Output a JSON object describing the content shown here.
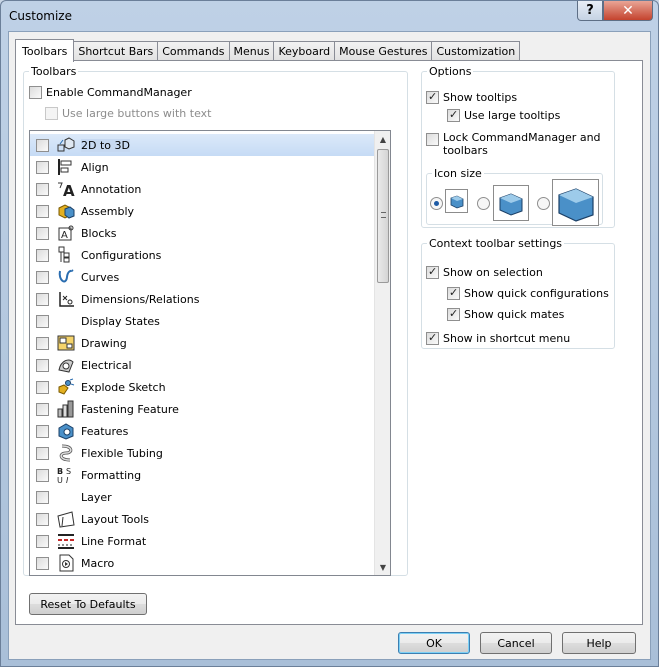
{
  "window": {
    "title": "Customize",
    "help_glyph": "?",
    "close_glyph": "✕"
  },
  "tabs": [
    {
      "label": "Toolbars",
      "active": true
    },
    {
      "label": "Shortcut Bars"
    },
    {
      "label": "Commands"
    },
    {
      "label": "Menus"
    },
    {
      "label": "Keyboard"
    },
    {
      "label": "Mouse Gestures"
    },
    {
      "label": "Customization"
    }
  ],
  "toolbars_group": {
    "legend": "Toolbars",
    "enable_commandmanager": {
      "label": "Enable CommandManager",
      "checked": false
    },
    "use_large_buttons": {
      "label": "Use large buttons with text",
      "checked": false,
      "disabled": true
    },
    "items": [
      {
        "label": "2D to 3D",
        "icon": "2d-to-3d-icon",
        "checked": false,
        "selected": true
      },
      {
        "label": "Align",
        "icon": "align-icon",
        "checked": false
      },
      {
        "label": "Annotation",
        "icon": "annotation-icon",
        "checked": false
      },
      {
        "label": "Assembly",
        "icon": "assembly-icon",
        "checked": false
      },
      {
        "label": "Blocks",
        "icon": "blocks-icon",
        "checked": false
      },
      {
        "label": "Configurations",
        "icon": "configurations-icon",
        "checked": false
      },
      {
        "label": "Curves",
        "icon": "curves-icon",
        "checked": false
      },
      {
        "label": "Dimensions/Relations",
        "icon": "dimensions-icon",
        "checked": false
      },
      {
        "label": "Display States",
        "icon": "",
        "checked": false
      },
      {
        "label": "Drawing",
        "icon": "drawing-icon",
        "checked": false
      },
      {
        "label": "Electrical",
        "icon": "electrical-icon",
        "checked": false
      },
      {
        "label": "Explode Sketch",
        "icon": "explode-sketch-icon",
        "checked": false
      },
      {
        "label": "Fastening Feature",
        "icon": "fastening-feature-icon",
        "checked": false
      },
      {
        "label": "Features",
        "icon": "features-icon",
        "checked": false
      },
      {
        "label": "Flexible Tubing",
        "icon": "flexible-tubing-icon",
        "checked": false
      },
      {
        "label": "Formatting",
        "icon": "formatting-icon",
        "checked": false
      },
      {
        "label": "Layer",
        "icon": "",
        "checked": false
      },
      {
        "label": "Layout Tools",
        "icon": "layout-tools-icon",
        "checked": false
      },
      {
        "label": "Line Format",
        "icon": "line-format-icon",
        "checked": false
      },
      {
        "label": "Macro",
        "icon": "macro-icon",
        "checked": false
      }
    ]
  },
  "options_group": {
    "legend": "Options",
    "show_tooltips": {
      "label": "Show tooltips",
      "checked": true
    },
    "use_large_tooltips": {
      "label": "Use large tooltips",
      "checked": true
    },
    "lock_commandmanager": {
      "label_line1": "Lock CommandManager and",
      "label_line2": "toolbars",
      "checked": false
    },
    "icon_size": {
      "legend": "Icon size",
      "options": [
        "small",
        "medium",
        "large"
      ],
      "selected": "small"
    }
  },
  "context_group": {
    "legend": "Context toolbar settings",
    "show_on_selection": {
      "label": "Show on selection",
      "checked": true
    },
    "show_quick_configurations": {
      "label": "Show quick configurations",
      "checked": true
    },
    "show_quick_mates": {
      "label": "Show quick mates",
      "checked": true
    },
    "show_in_shortcut_menu": {
      "label": "Show in shortcut menu",
      "checked": true
    }
  },
  "buttons": {
    "reset": "Reset To Defaults",
    "ok": "OK",
    "cancel": "Cancel",
    "help": "Help"
  },
  "colors": {
    "selection": "#c6dbf5",
    "accent": "#1d5aa5",
    "icon_blue": "#4a90c8"
  }
}
